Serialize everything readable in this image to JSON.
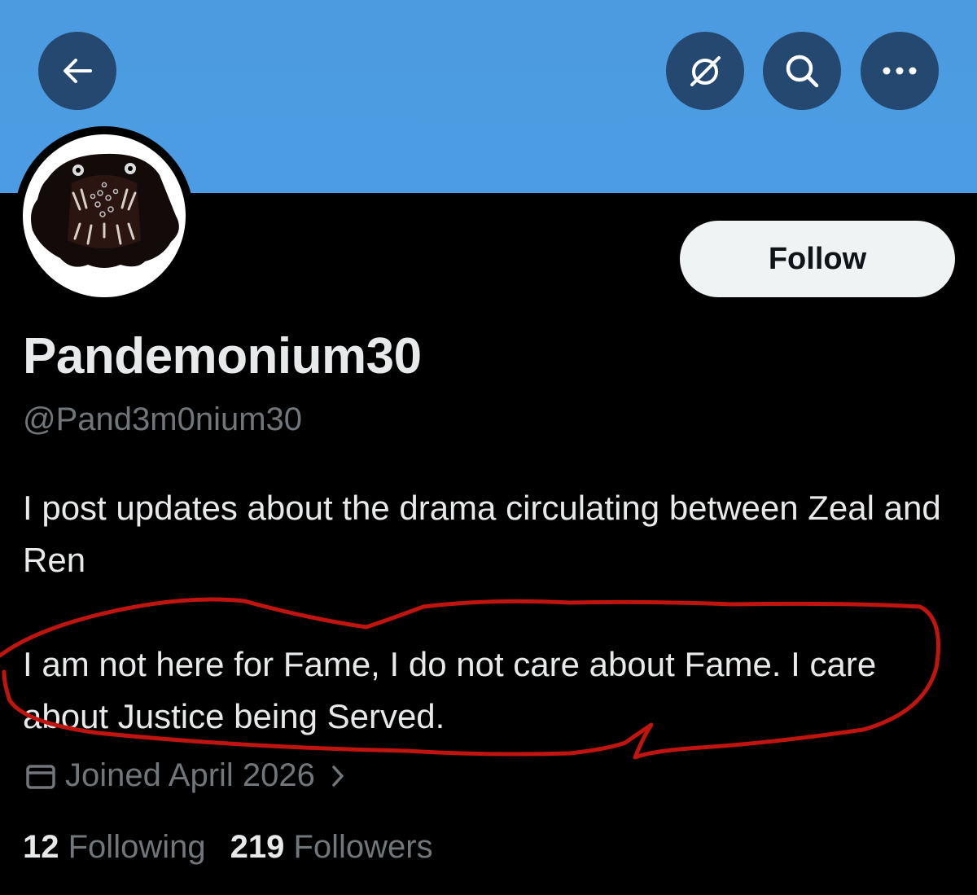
{
  "header": {
    "back_icon": "arrow-left-icon",
    "grok_icon": "grok-slash-circle-icon",
    "search_icon": "search-icon",
    "more_icon": "more-dots-icon",
    "banner_color": "#4b9ce3"
  },
  "profile": {
    "display_name": "Pandemonium30",
    "handle": "@Pand3m0nium30",
    "bio_line1": "I post updates about the drama circulating between Zeal and Ren",
    "bio_line2": "I am not here for Fame, I do not care about Fame. I care about Justice being Served.",
    "joined": "Joined April 2026",
    "follow_label": "Follow"
  },
  "stats": {
    "following_count": "12",
    "following_label": "Following",
    "followers_count": "219",
    "followers_label": "Followers"
  },
  "annotation": {
    "color": "#c0150f",
    "type": "hand-drawn circle around bio"
  }
}
